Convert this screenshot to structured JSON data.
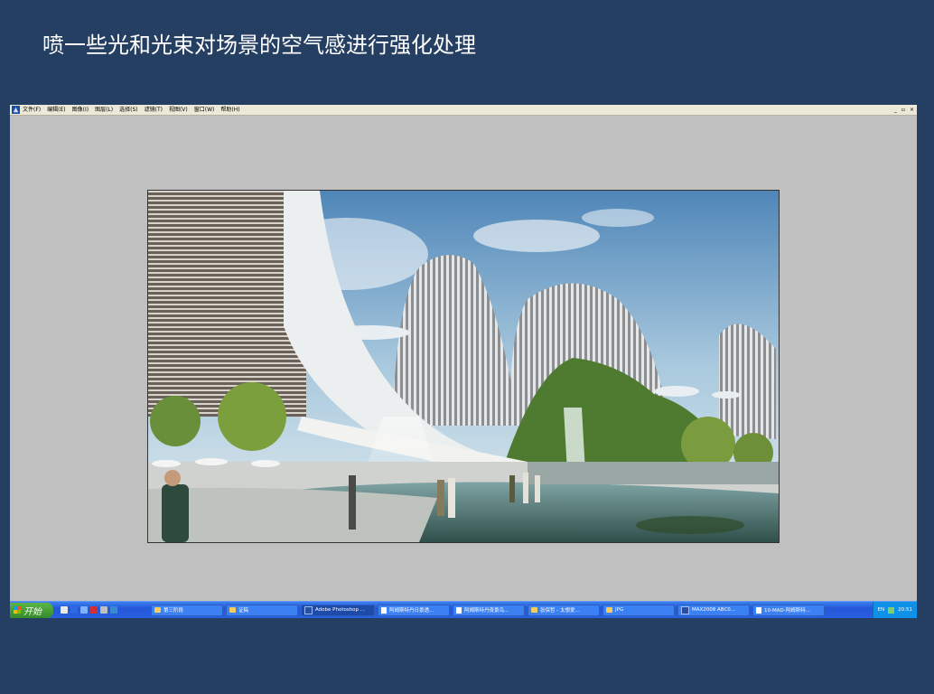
{
  "slide": {
    "title": "喷一些光和光束对场景的空气感进行强化处理"
  },
  "photoshop": {
    "menu": [
      "文件(F)",
      "编辑(E)",
      "图像(I)",
      "图层(L)",
      "选择(S)",
      "滤镜(T)",
      "视图(V)",
      "窗口(W)",
      "帮助(H)"
    ],
    "window_controls": [
      "_",
      "▫",
      "×"
    ]
  },
  "taskbar": {
    "start_label": "开始",
    "quicklaunch_colors": [
      "#e8e8e8",
      "#2d6ae0",
      "#7fb3ff",
      "#d03030",
      "#c0c0c0",
      "#3a8ad0"
    ],
    "buttons": [
      {
        "label": "第三阶段",
        "icon": "folder-icon",
        "width": 80,
        "active": false
      },
      {
        "label": "证稿",
        "icon": "folder-icon",
        "width": 80,
        "active": false
      },
      {
        "label": "Adobe Photoshop ...",
        "icon": "photoshop-icon",
        "width": 82,
        "active": true
      },
      {
        "label": "阿姆斯特丹日景透...",
        "icon": "document-icon",
        "width": 80,
        "active": false
      },
      {
        "label": "阿姆斯特丹夜景鸟...",
        "icon": "document-icon",
        "width": 80,
        "active": false
      },
      {
        "label": "张保哲 - 太想爱...",
        "icon": "folder-icon",
        "width": 80,
        "active": false
      },
      {
        "label": "JPG",
        "icon": "folder-icon",
        "width": 80,
        "active": false
      },
      {
        "label": "MAX2008   ABC0...",
        "icon": "app-icon",
        "width": 80,
        "active": false
      },
      {
        "label": "10-MAD-阿姆斯特...",
        "icon": "document-icon",
        "width": 80,
        "active": false
      }
    ],
    "tray": {
      "lang": "EN",
      "time": "20:51"
    }
  }
}
